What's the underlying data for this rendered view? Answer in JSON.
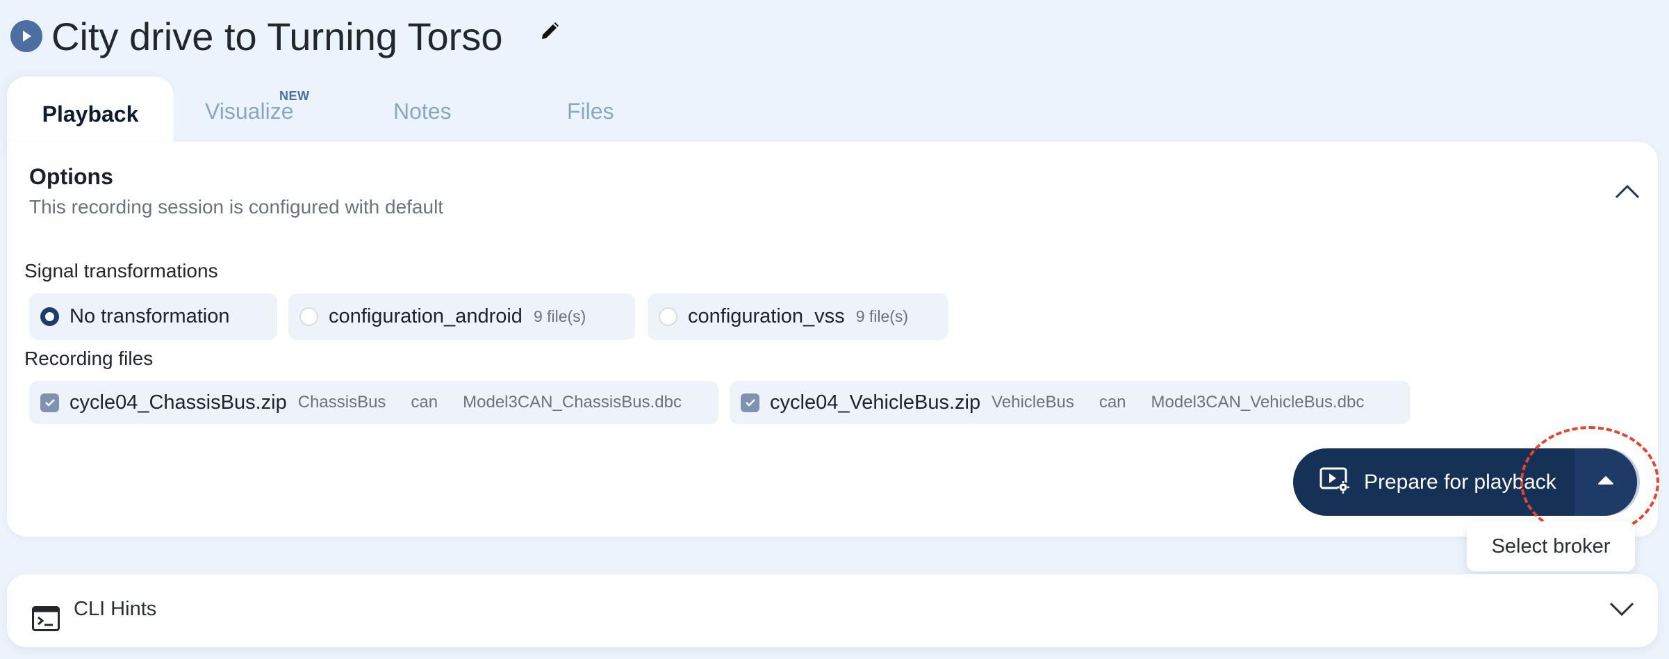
{
  "header": {
    "title": "City drive to Turning Torso",
    "status_icon": "play-circle-icon",
    "edit_icon": "pencil-icon"
  },
  "tabs": [
    {
      "label": "Playback",
      "active": true
    },
    {
      "label": "Visualize",
      "badge": "NEW"
    },
    {
      "label": "Notes"
    },
    {
      "label": "Files"
    }
  ],
  "options": {
    "title": "Options",
    "subtitle": "This recording session is configured with default",
    "collapse_icon": "chevron-up-icon",
    "signal_transformations": {
      "label": "Signal transformations",
      "items": [
        {
          "label": "No transformation",
          "selected": true
        },
        {
          "label": "configuration_android",
          "meta": "9 file(s)",
          "selected": false
        },
        {
          "label": "configuration_vss",
          "meta": "9 file(s)",
          "selected": false
        }
      ]
    },
    "recording_files": {
      "label": "Recording files",
      "items": [
        {
          "name": "cycle04_ChassisBus.zip",
          "namespace": "ChassisBus",
          "type": "can",
          "database": "Model3CAN_ChassisBus.dbc",
          "checked": true
        },
        {
          "name": "cycle04_VehicleBus.zip",
          "namespace": "VehicleBus",
          "type": "can",
          "database": "Model3CAN_VehicleBus.dbc",
          "checked": true
        }
      ]
    },
    "prepare_button": {
      "label": "Prepare for playback",
      "icon": "video-settings-icon",
      "dropdown_icon": "caret-up-icon"
    },
    "tooltip": "Select broker"
  },
  "cli_hints": {
    "label": "CLI Hints",
    "icon": "terminal-icon",
    "expand_icon": "chevron-down-icon"
  },
  "colors": {
    "background": "#ebf3fc",
    "primary": "#163156",
    "accent": "#4a6fa0",
    "chip": "#eef3f9",
    "highlight": "#e8432c"
  }
}
